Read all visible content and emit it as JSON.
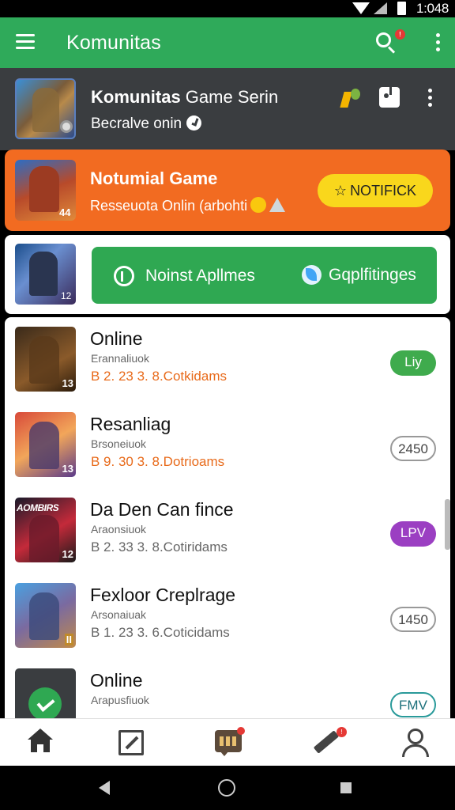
{
  "status_bar": {
    "time": "1:048"
  },
  "app_bar": {
    "title": "Komunitas"
  },
  "profile": {
    "name_bold": "Komunitas",
    "name_rest": " Game Serin",
    "subtitle": "Becralve onin"
  },
  "promo": {
    "title": "Notumial Game",
    "subtitle": "Resseuota Onlin (arbohti",
    "thumb_number": "44",
    "button_label": "NOTIFICK"
  },
  "actions": {
    "thumb_number": "12",
    "label_left": "Noinst Apllmes",
    "label_right": "Gqplfitinges"
  },
  "list_items": [
    {
      "title": "Online",
      "subtitle": "Erannaliuok",
      "meta": "B 2. 23 3. 8.Cotkidams",
      "meta_color": "#e86a1a",
      "badge": "Liy",
      "badge_style": "green",
      "thumb_number": "13"
    },
    {
      "title": "Resanliag",
      "subtitle": "Brsoneiuok",
      "meta": "B 9. 30 3. 8.Dotrioams",
      "meta_color": "#e86a1a",
      "badge": "2450",
      "badge_style": "outline",
      "thumb_number": "13"
    },
    {
      "title": "Da Den Can fince",
      "subtitle": "Araonsiuok",
      "meta": "B 2. 33 3. 8.Cotiridams",
      "meta_color": "#666666",
      "badge": "LPV",
      "badge_style": "purple",
      "thumb_number": "12",
      "thumb_title": "AOMBIRS"
    },
    {
      "title": "Fexloor Creplrage",
      "subtitle": "Arsonaiuak",
      "meta": "B 1. 23 3. 6.Coticidams",
      "meta_color": "#666666",
      "badge": "1450",
      "badge_style": "outline",
      "thumb_number": "II"
    },
    {
      "title": "Online",
      "subtitle": "Arapusfiuok",
      "meta": "",
      "meta_color": "#666666",
      "badge": "FMV",
      "badge_style": "teal"
    }
  ],
  "nav": {
    "chat_badge": "",
    "pen_badge": "!"
  },
  "colors": {
    "green": "#2faa5a",
    "orange": "#f26b21",
    "yellow": "#f9d71c",
    "dark": "#3a3d40",
    "purple": "#9b3fc2"
  }
}
